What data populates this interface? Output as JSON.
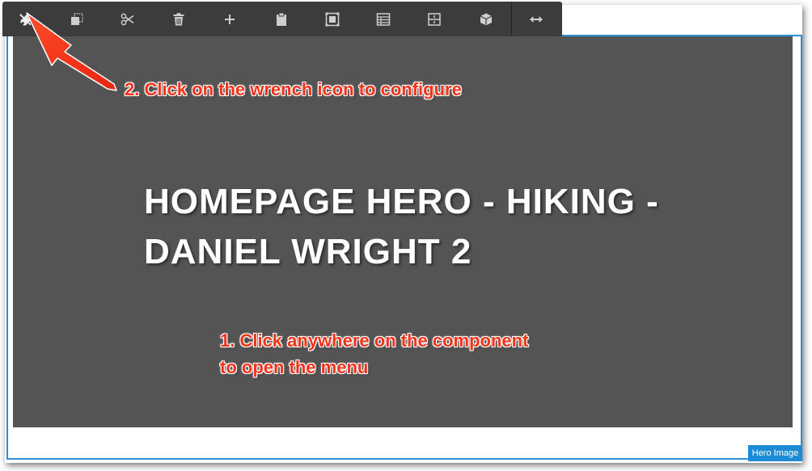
{
  "toolbar": {
    "buttons": [
      {
        "name": "configure",
        "icon": "wrench-icon"
      },
      {
        "name": "copy",
        "icon": "copy-icon"
      },
      {
        "name": "cut",
        "icon": "scissors-icon"
      },
      {
        "name": "delete",
        "icon": "trash-icon"
      },
      {
        "name": "insert",
        "icon": "plus-icon"
      },
      {
        "name": "paste",
        "icon": "clipboard-icon"
      },
      {
        "name": "group",
        "icon": "group-icon"
      },
      {
        "name": "parent",
        "icon": "layout-icon"
      },
      {
        "name": "layout",
        "icon": "panel-icon"
      },
      {
        "name": "convert",
        "icon": "cube-icon"
      },
      {
        "name": "resize",
        "icon": "arrows-horizontal-icon"
      }
    ]
  },
  "hero": {
    "title_line1": "HOMEPAGE HERO - HIKING -",
    "title_line2": "DANIEL WRIGHT 2"
  },
  "annotations": {
    "step2": "2. Click on the wrench icon to configure",
    "step1_line1": "1. Click anywhere on the component",
    "step1_line2": "to open the menu"
  },
  "component_label": "Hero Image",
  "colors": {
    "accent": "#1c8bd6",
    "annotation": "#f5331a",
    "toolbar": "#3c3c3c",
    "hero_background": "#545454"
  }
}
